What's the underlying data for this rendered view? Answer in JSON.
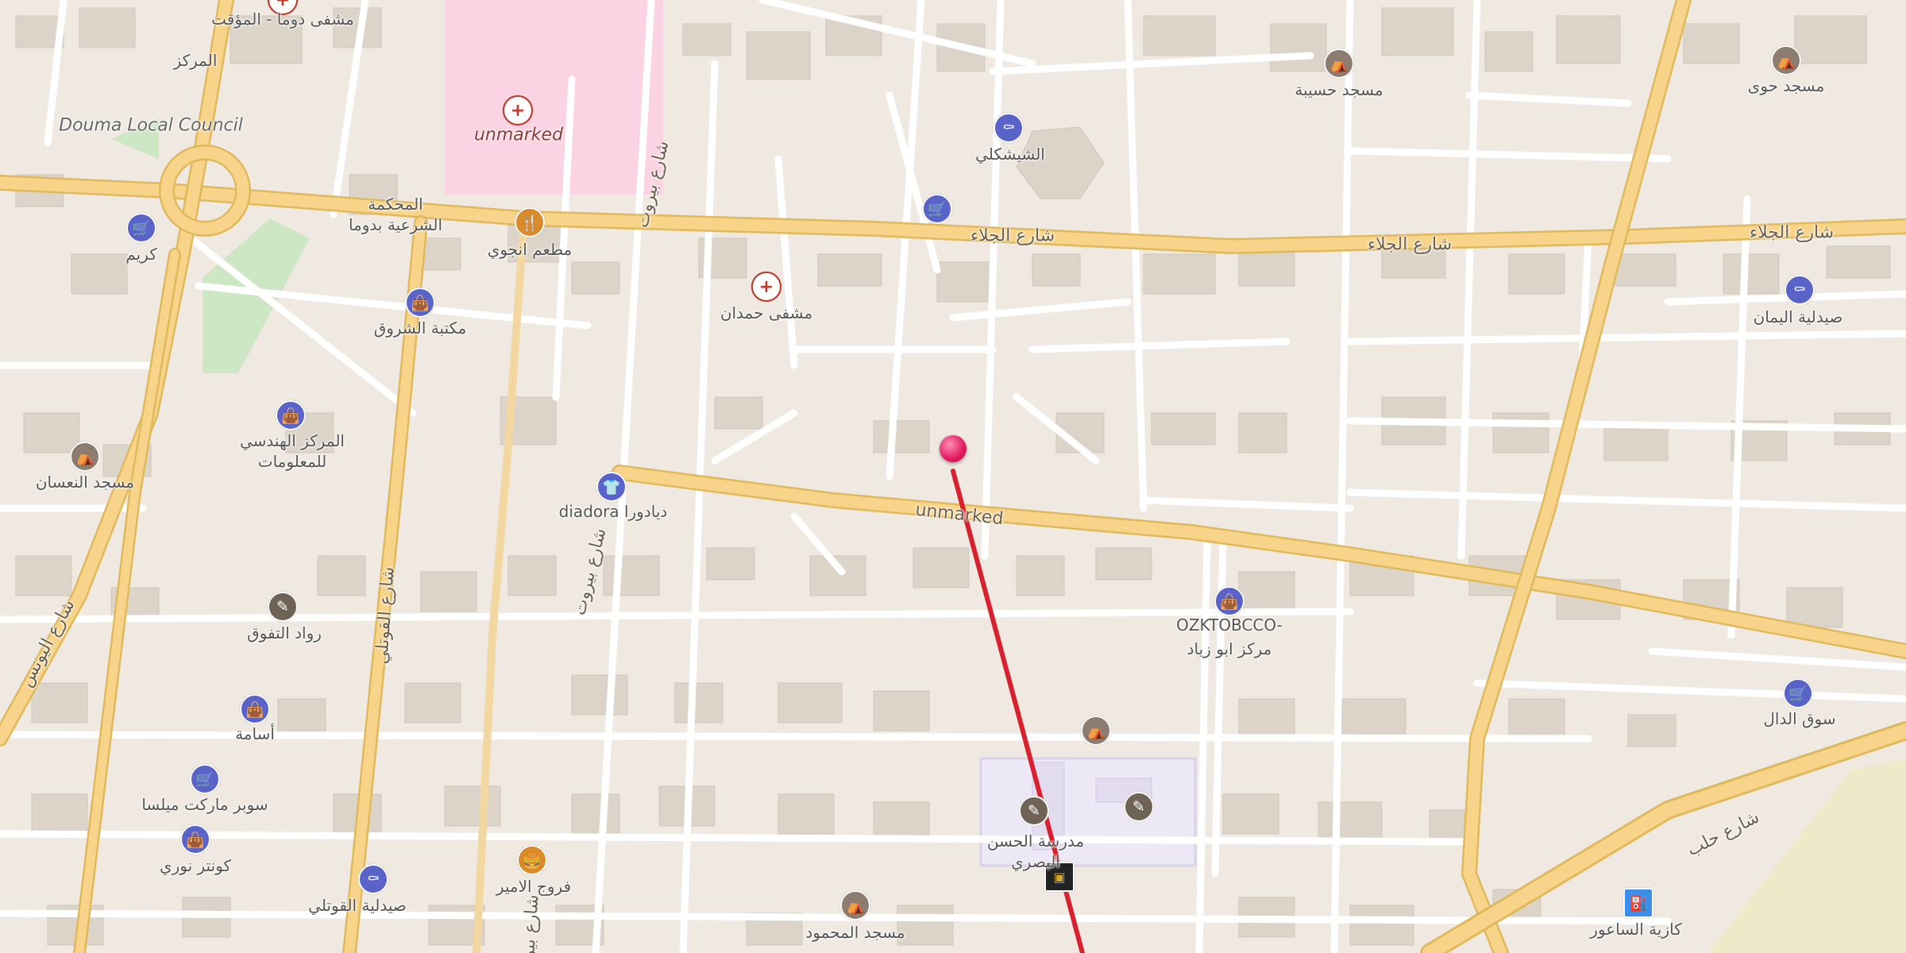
{
  "map": {
    "colors": {
      "background": "#efe9e1",
      "building": "#ddd4c9",
      "major_road": "#f7d48a",
      "minor_road": "#ffffff",
      "hospital_area": "#fbd3e2",
      "school_area": "#ece8f6",
      "park": "#cde6c4",
      "route": "#d8202e",
      "pin": "#e2195f"
    },
    "pin": {
      "name": "destination-pin"
    },
    "route": {
      "color": "#d8202e"
    },
    "labels": {
      "hospital_top": "مشفى دوما - المؤقت",
      "center_top": "المركز",
      "douma_council": "Douma Local Council",
      "hospital_unmarked": "unmarked",
      "court": "المحكمة\nالشرعية بدوما",
      "restaurant": "مطعم انجوي",
      "karim": "كريم",
      "library": "مكتبة الشروق",
      "eng_center": "المركز الهندسي\nللمعلومات",
      "mosque_numan": "مسجد النعسان",
      "diadora": "diadora ديادورا",
      "unmarked_road": "unmarked",
      "rowad": "رواد التفوق",
      "osama": "أسامة",
      "supermarket": "سوبر ماركت ميلسا",
      "counter_nouri": "كونتر نوري",
      "pharmacy_qatli": "صيدلية القوتلي",
      "frouj": "فروج الامير",
      "mosque_mahmoud": "مسجد المحمود",
      "school": "مدرسة الحسن\nالبصري",
      "hamdan": "مشفى حمدان",
      "shishakli": "الشيشكلي",
      "jalaa_1": "شارع الجلاء",
      "jalaa_2": "شارع الجلاء",
      "jalaa_3": "شارع الجلاء",
      "mosque_hasiba": "مسجد حسيبة",
      "mosque_hawi": "مسجد حوى",
      "pharmacy_yaman": "صيدلية اليمان",
      "ozk": "OZKTOBCCO-\nمركز ابو زياد",
      "souq": "سوق الدال",
      "halab": "شارع حلب",
      "fuel": "كازية الساعور",
      "quwatli": "شارع القوتلي",
      "beirut_1": "شارع بيروت",
      "beirut_2": "شارع بيروت",
      "beirut_3": "شارع بيرو",
      "younis": "شارع اليونس"
    }
  }
}
